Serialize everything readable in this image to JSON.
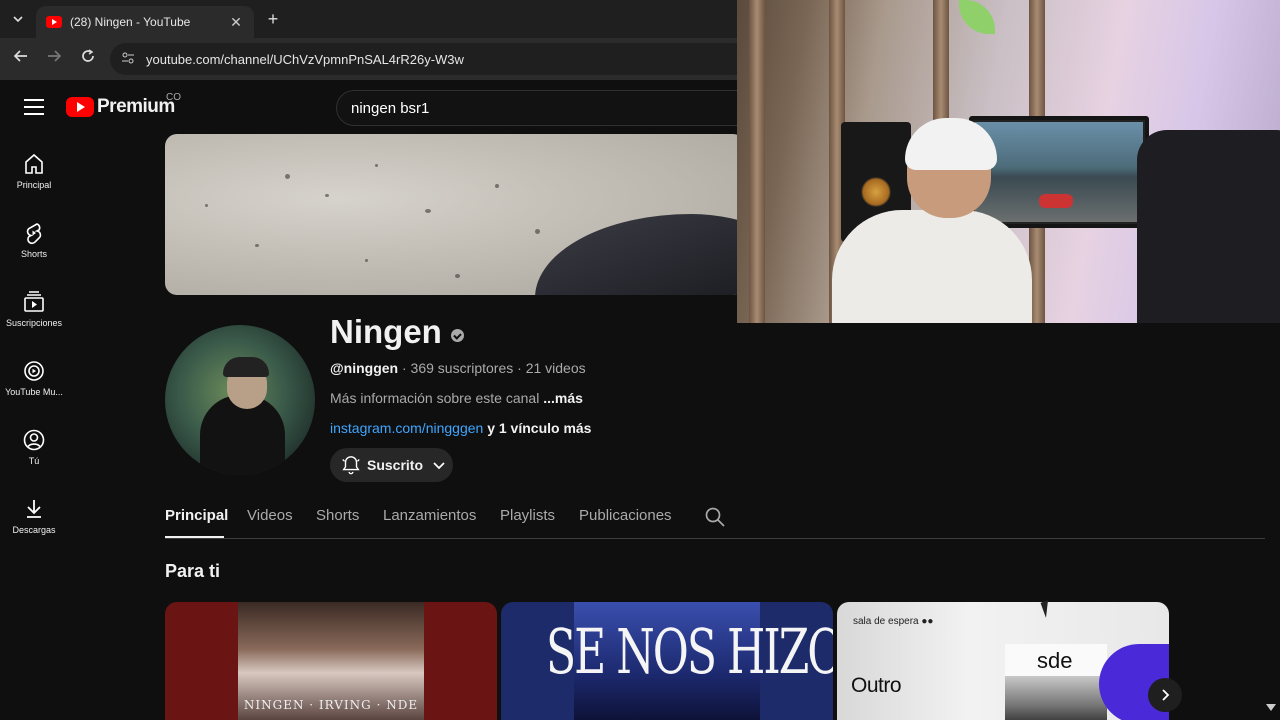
{
  "browser": {
    "tab_title": "(28) Ningen - YouTube",
    "tab_close": "✕",
    "new_tab": "+",
    "url": "youtube.com/channel/UChVzVpmnPnSAL4rR26y-W3w"
  },
  "masthead": {
    "logo_word": "Premium",
    "country_code": "CO",
    "search_value": "ningen  bsr1"
  },
  "guide": {
    "items": [
      {
        "label": "Principal",
        "icon": "home-icon"
      },
      {
        "label": "Shorts",
        "icon": "shorts-icon"
      },
      {
        "label": "Suscripciones",
        "icon": "subscriptions-icon"
      },
      {
        "label": "YouTube Mu...",
        "icon": "youtube-music-icon"
      },
      {
        "label": "Tú",
        "icon": "you-icon"
      },
      {
        "label": "Descargas",
        "icon": "downloads-icon"
      }
    ]
  },
  "channel": {
    "name": "Ningen",
    "handle": "@ninggen",
    "meta_rest": " · 369 suscriptores · 21 videos",
    "description": "Más información sobre este canal ",
    "more": "...más",
    "link": "instagram.com/ningggen",
    "extra_links": " y 1 vínculo más",
    "subscribed_label": "Suscrito"
  },
  "tabs": [
    "Principal",
    "Videos",
    "Shorts",
    "Lanzamientos",
    "Playlists",
    "Publicaciones"
  ],
  "section": {
    "title": "Para ti"
  },
  "videos": [
    {
      "caption": "NINGEN · IRVING · NDE"
    },
    {
      "art_text": "SE NOS HIZO TARDE"
    },
    {
      "tag": "sala de espera ●●",
      "title": "Outro",
      "cover_text": "sde"
    }
  ],
  "colors": {
    "background": "#0f0f0f",
    "brand_red": "#ff0000",
    "link_blue": "#3ea6ff",
    "muted_text": "#aaaaaa"
  }
}
